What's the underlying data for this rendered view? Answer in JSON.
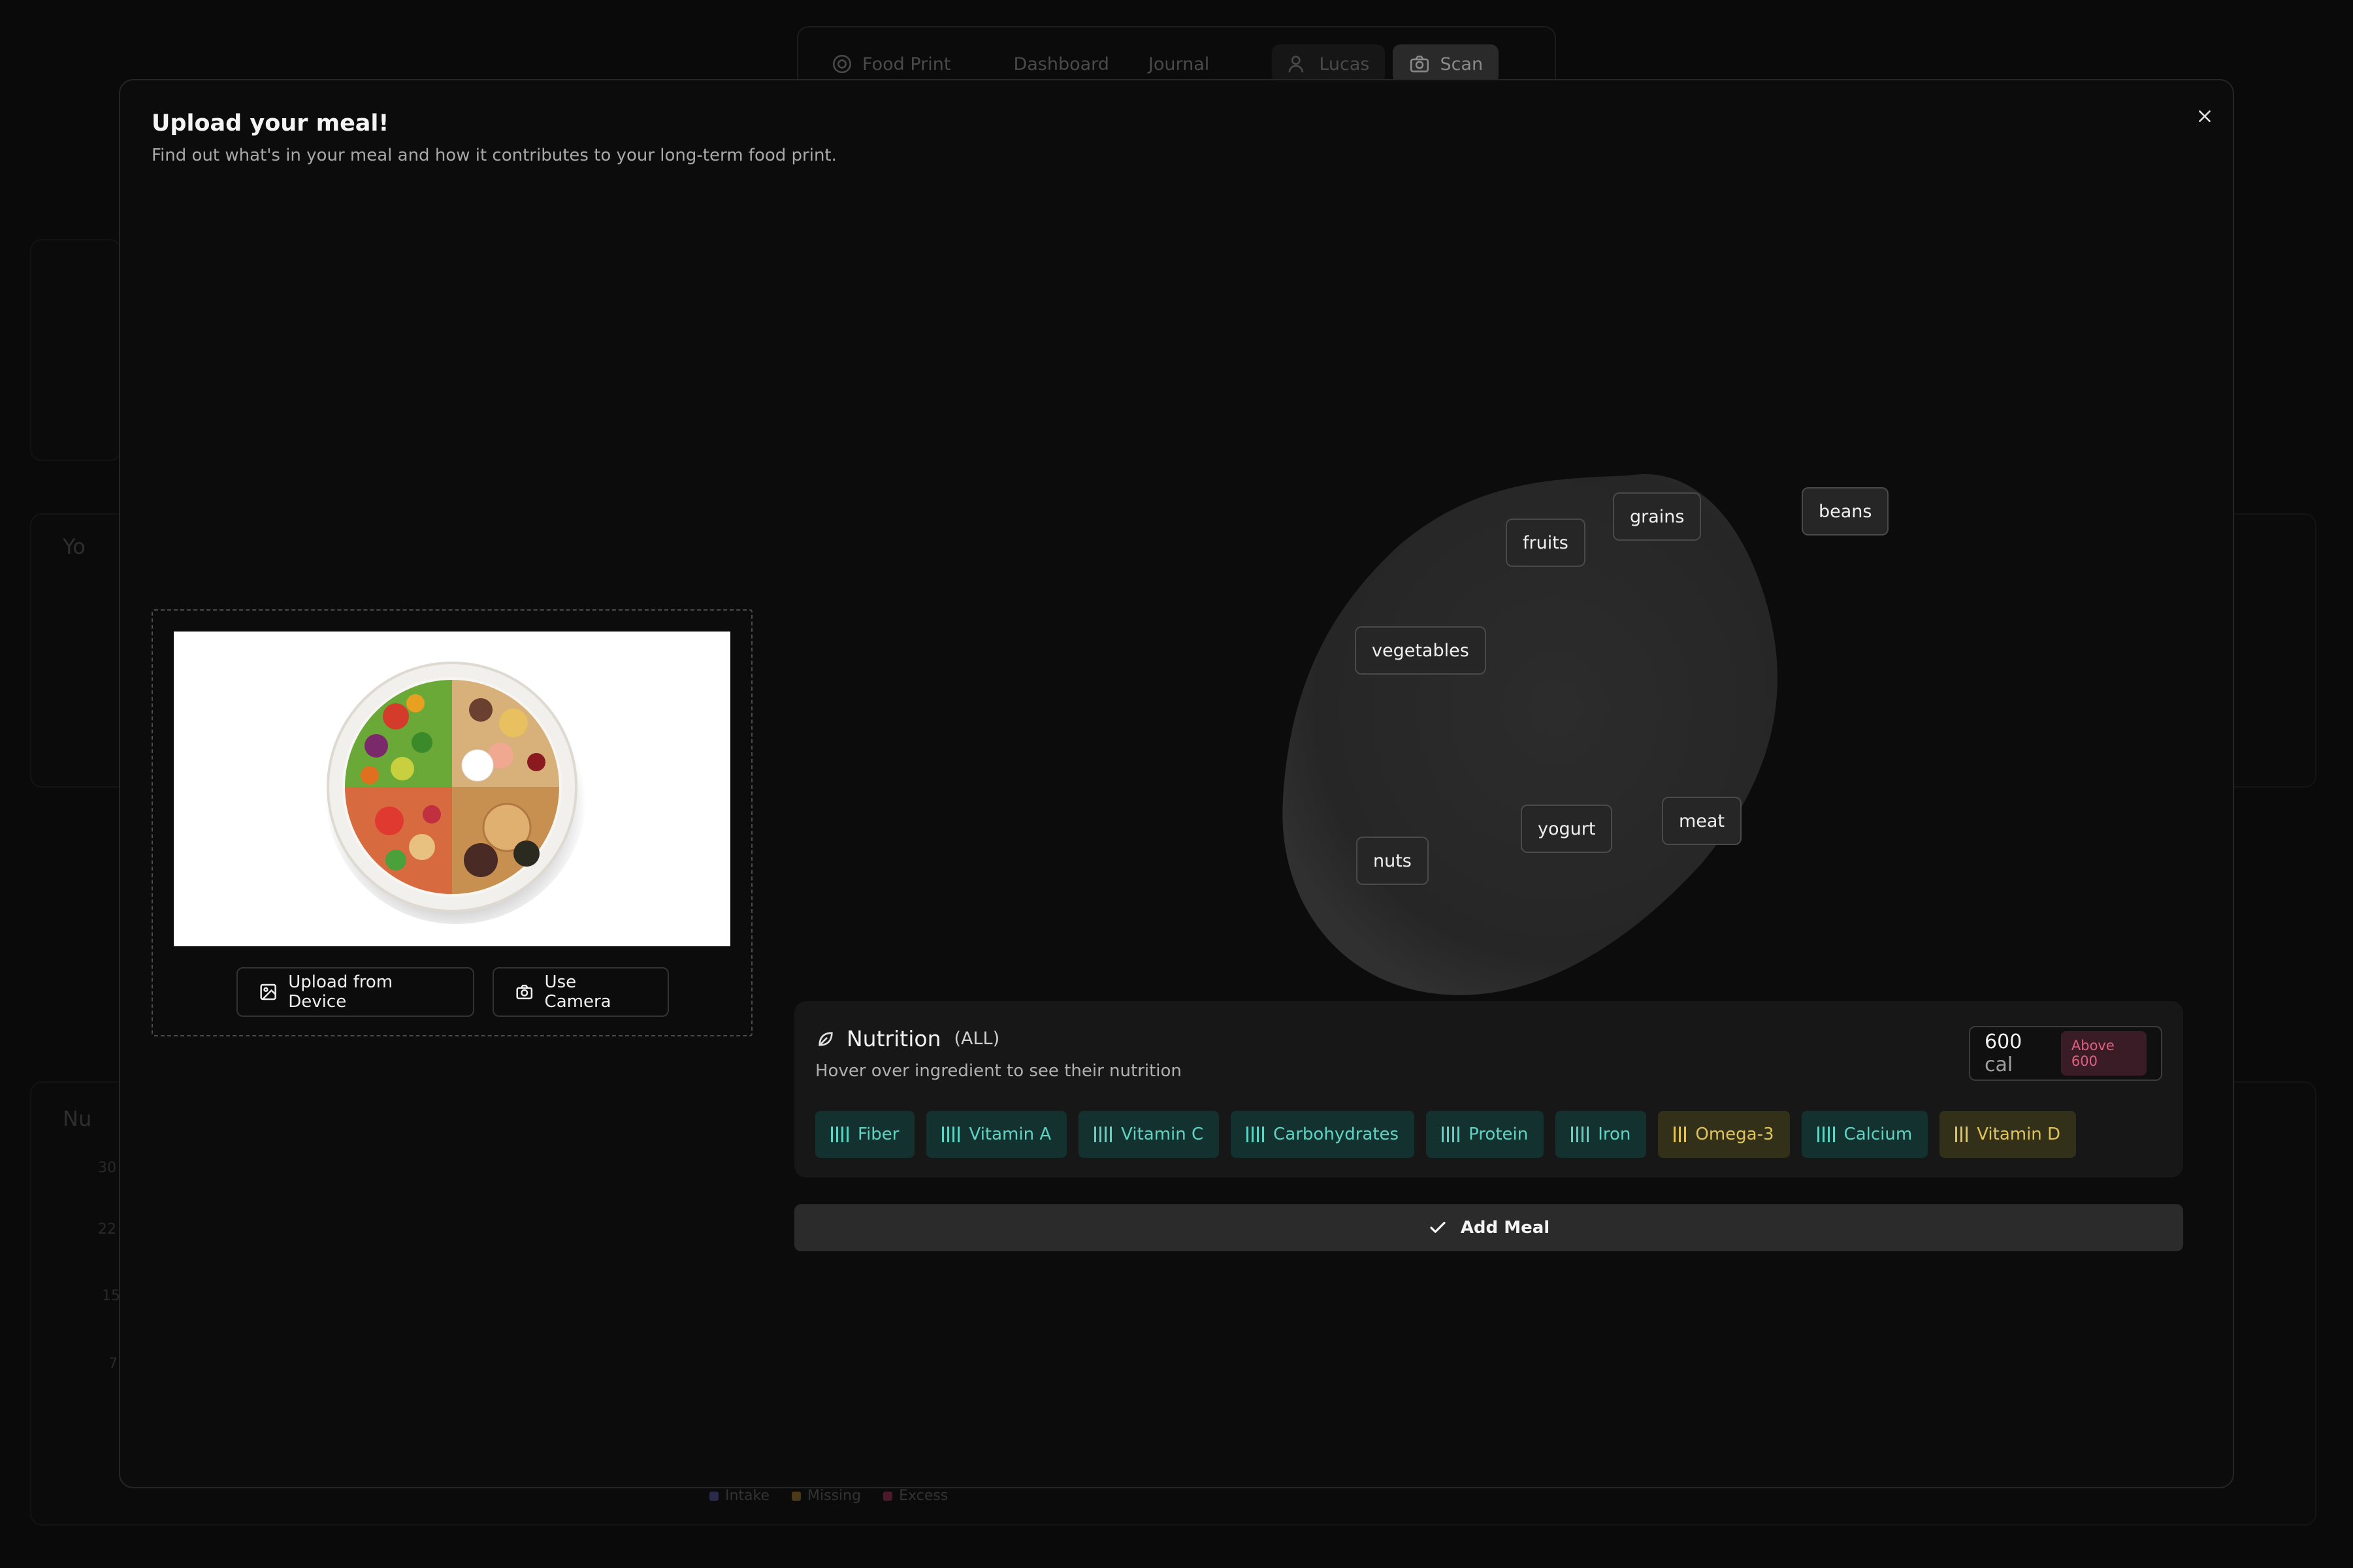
{
  "nav": {
    "brand": "Food Print",
    "dashboard": "Dashboard",
    "journal": "Journal",
    "user": "Lucas",
    "scan": "Scan"
  },
  "background": {
    "your_section_label": "Yo",
    "nutrition_section_label": "Nu",
    "y_ticks": [
      "30",
      "22",
      "15",
      "7"
    ],
    "legend": [
      {
        "label": "Intake",
        "color": "#2a2a4a"
      },
      {
        "label": "Missing",
        "color": "#4a3a1a"
      },
      {
        "label": "Excess",
        "color": "#4a1a2a"
      }
    ]
  },
  "modal": {
    "title": "Upload your meal!",
    "subtitle": "Find out what's in your meal and how it contributes to your long-term food print.",
    "upload_device_label": "Upload from Device",
    "use_camera_label": "Use Camera",
    "ingredients": [
      "fruits",
      "grains",
      "beans",
      "vegetables",
      "yogurt",
      "meat",
      "nuts"
    ],
    "nutrition": {
      "title": "Nutrition",
      "filter": "(ALL)",
      "hint": "Hover over ingredient to see their nutrition",
      "calories_value": "600",
      "calories_unit": "cal",
      "calories_badge": "Above 600",
      "tags": [
        {
          "label": "Fiber",
          "status": "teal"
        },
        {
          "label": "Vitamin A",
          "status": "teal"
        },
        {
          "label": "Vitamin C",
          "status": "teal"
        },
        {
          "label": "Carbohydrates",
          "status": "teal"
        },
        {
          "label": "Protein",
          "status": "teal"
        },
        {
          "label": "Iron",
          "status": "teal"
        },
        {
          "label": "Omega-3",
          "status": "gold"
        },
        {
          "label": "Calcium",
          "status": "teal"
        },
        {
          "label": "Vitamin D",
          "status": "gold"
        }
      ]
    },
    "add_meal_label": "Add Meal"
  },
  "colors": {
    "teal_tag_bg": "#13312f",
    "teal_tag_text": "#5fd4c4",
    "gold_tag_bg": "#33301a",
    "gold_tag_text": "#e0c35a",
    "badge_text": "#e06080"
  }
}
